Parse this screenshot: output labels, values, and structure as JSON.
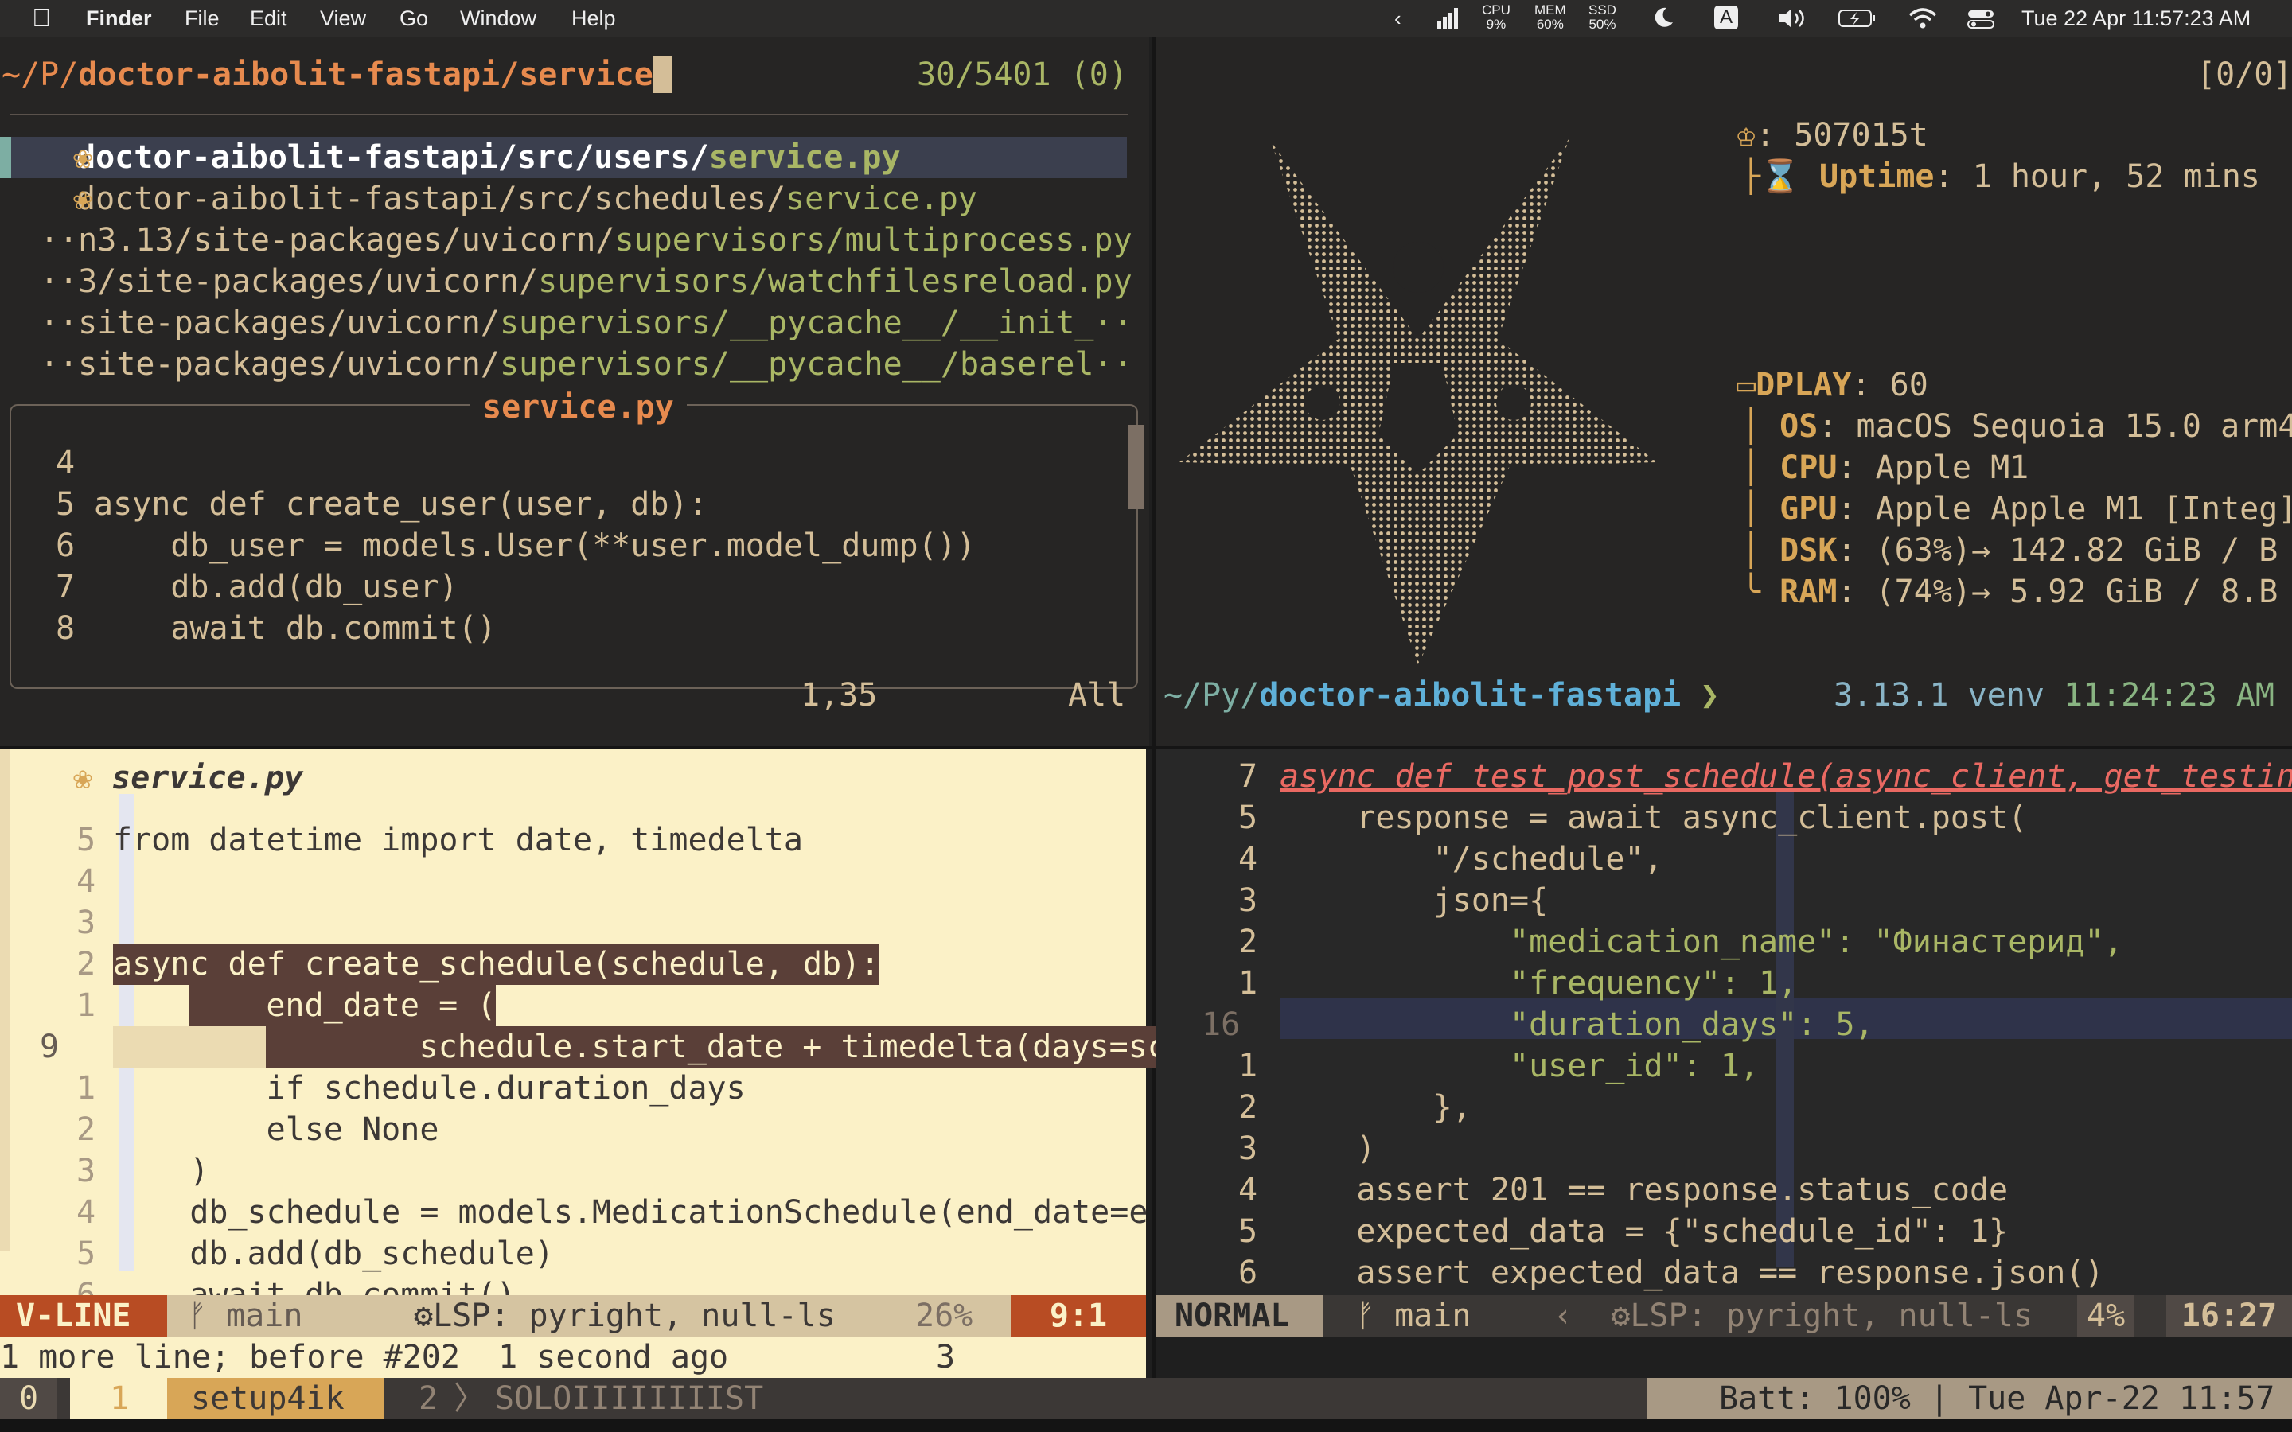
{
  "menubar": {
    "app": "Finder",
    "items": [
      "File",
      "Edit",
      "View",
      "Go",
      "Window",
      "Help"
    ],
    "cpu": "CPU\n9%",
    "mem": "MEM\n60%",
    "ssd": "SSD\n50%",
    "input_source": "A",
    "datetime": "Tue 22 Apr  11:57:23 AM"
  },
  "finder_pane": {
    "prompt_path_prefix": "~/P/",
    "prompt_path_rest": "doctor-aibolit-fastapi/service",
    "match_count": "30/5401 (0)",
    "results": [
      {
        "dim": "doctor-aibolit-fastapi/src/users/",
        "match": "service.py",
        "icon": "python-icon"
      },
      {
        "dim": "doctor-aibolit-fastapi/src/schedules/",
        "match": "service.py",
        "icon": "python-icon"
      },
      {
        "dim": "··n3.13/site-packages/uvicorn/",
        "match": "supervisors/multiprocess.py",
        "icon": ""
      },
      {
        "dim": "··3/site-packages/uvicorn/",
        "match": "supervisors/watchfilesreload.py",
        "icon": ""
      },
      {
        "dim": "··site-packages/uvicorn/",
        "match": "supervisors/__pycache__/__init_··",
        "icon": ""
      },
      {
        "dim": "··site-packages/uvicorn/",
        "match": "supervisors/__pycache__/baserel··",
        "icon": ""
      }
    ],
    "preview_title": "service.py",
    "preview_lines": [
      {
        "n": "4",
        "code": ""
      },
      {
        "n": "5",
        "code": "async def create_user(user, db):"
      },
      {
        "n": "6",
        "code": "    db_user = models.User(**user.model_dump())"
      },
      {
        "n": "7",
        "code": "    db.add(db_user)"
      },
      {
        "n": "8",
        "code": "    await db.commit()"
      }
    ],
    "cursor_pos": "1,35",
    "scroll": "All"
  },
  "fetch_pane": {
    "counter": "[0/0]",
    "packages": ": 507015t",
    "uptime_label": "Uptime",
    "uptime": ": 1 hour, 52 mins",
    "info": [
      {
        "label": "DPLAY",
        "value": ": 60"
      },
      {
        "label": "OS",
        "value": ": macOS Sequoia 15.0 arm4"
      },
      {
        "label": "CPU",
        "value": ": Apple M1"
      },
      {
        "label": "GPU",
        "value": ": Apple Apple M1 [Integ]"
      },
      {
        "label": "DSK",
        "value": ": (63%)→ 142.82 GiB / B"
      },
      {
        "label": "RAM",
        "value": ": (74%)→ 5.92 GiB / 8.B"
      }
    ],
    "prompt_path_prefix": "~/Py/",
    "prompt_path_rest": "doctor-aibolit-fastapi",
    "prompt_arrow": "❯",
    "python_version": "3.13.1",
    "venv": "venv",
    "time": "11:24:23 AM"
  },
  "editor_left": {
    "filename": "service.py",
    "mode": "V-LINE",
    "branch": "main",
    "lsp": "LSP: pyright, null-ls",
    "percent": "26%",
    "position": "9:1",
    "message": "1 more line; before #202  1 second ago",
    "message_count": "3",
    "lines": [
      {
        "n": "5",
        "code": "from datetime import date, timedelta"
      },
      {
        "n": "4",
        "code": ""
      },
      {
        "n": "3",
        "code": ""
      },
      {
        "n": "2",
        "code": "async def create_schedule(schedule, db):"
      },
      {
        "n": "1",
        "code": "    end_date = ("
      },
      {
        "n": "9",
        "code": "        schedule.start_date + timedelta(days=schedule."
      },
      {
        "n": "1",
        "code": "        if schedule.duration_days"
      },
      {
        "n": "2",
        "code": "        else None"
      },
      {
        "n": "3",
        "code": "    )"
      },
      {
        "n": "4",
        "code": "    db_schedule = models.MedicationSchedule(end_date=e"
      },
      {
        "n": "5",
        "code": "    db.add(db_schedule)"
      },
      {
        "n": "6",
        "code": "    await db.commit()"
      }
    ]
  },
  "editor_right": {
    "mode": "NORMAL",
    "branch": "main",
    "lsp": "LSP: pyright, null-ls",
    "percent": "4%",
    "position": "16:27",
    "lines": [
      {
        "n": "7",
        "code": "async def test_post_schedule(async_client, get_testin"
      },
      {
        "n": "5",
        "code": "    response = await async_client.post("
      },
      {
        "n": "4",
        "code": "        \"/schedule\","
      },
      {
        "n": "3",
        "code": "        json={"
      },
      {
        "n": "2",
        "code": "            \"medication_name\": \"Финастерид\","
      },
      {
        "n": "1",
        "code": "            \"frequency\": 1,"
      },
      {
        "n": "16",
        "code": "            \"duration_days\": 5,"
      },
      {
        "n": "1",
        "code": "            \"user_id\": 1,"
      },
      {
        "n": "2",
        "code": "        },"
      },
      {
        "n": "3",
        "code": "    )"
      },
      {
        "n": "4",
        "code": "    assert 201 == response.status_code"
      },
      {
        "n": "5",
        "code": "    expected_data = {\"schedule_id\": 1}"
      },
      {
        "n": "6",
        "code": "    assert expected_data == response.json()"
      }
    ]
  },
  "tmux": {
    "session": "0",
    "windows": [
      {
        "index": "1",
        "name": "setup4ik",
        "active": true
      },
      {
        "index": "2",
        "name": "SOLOIIIIIIIIST",
        "active": false
      }
    ],
    "status_right": "Batt: 100% | Tue Apr-22 11:57"
  },
  "colors": {
    "bg_dark": "#262524",
    "bg_light": "#fbf1c7",
    "mode_vline": "#b84c23",
    "orange": "#e78a4e",
    "green": "#a9b665",
    "tmux_yellow": "#d8a657"
  }
}
